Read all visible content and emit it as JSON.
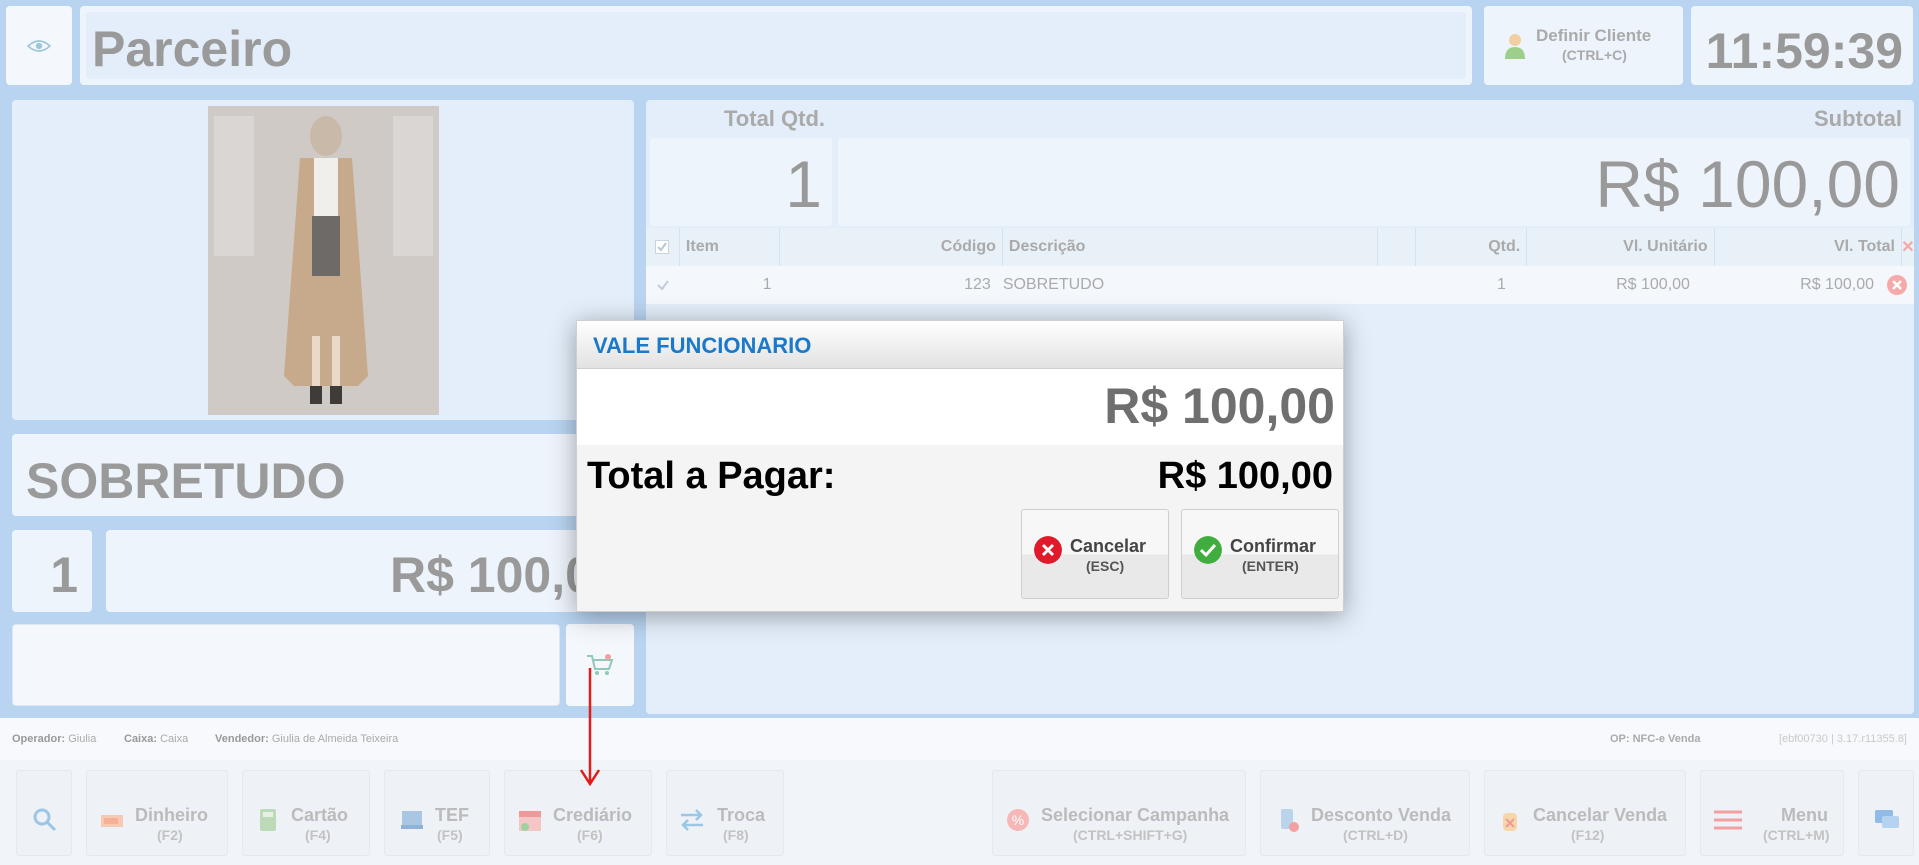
{
  "header": {
    "title": "Parceiro",
    "client_button": {
      "label": "Definir Cliente",
      "shortcut": "(CTRL+C)"
    },
    "clock": "11:59:39"
  },
  "product": {
    "name": "SOBRETUDO",
    "quantity": "1",
    "price": "R$ 100,00"
  },
  "totals": {
    "qty_label": "Total Qtd.",
    "qty_value": "1",
    "subtotal_label": "Subtotal",
    "subtotal_value": "R$ 100,00"
  },
  "table": {
    "headers": [
      "Item",
      "Código",
      "Descrição",
      "Qtd.",
      "Vl. Unitário",
      "Vl. Total"
    ],
    "rows": [
      {
        "item": "1",
        "codigo": "123",
        "descricao": "SOBRETUDO",
        "qtd": "1",
        "unitario": "R$ 100,00",
        "total": "R$ 100,00"
      }
    ]
  },
  "status": {
    "operador_label": "Operador:",
    "operador": "Giulia",
    "caixa_label": "Caixa:",
    "caixa": "Caixa",
    "vendedor_label": "Vendedor:",
    "vendedor": "Giulia de Almeida Teixeira",
    "op": "OP: NFC-e Venda",
    "version": "[ebf00730 | 3.17.r11355.8]"
  },
  "actions": [
    {
      "label": "Dinheiro",
      "key": "(F2)"
    },
    {
      "label": "Cartão",
      "key": "(F4)"
    },
    {
      "label": "TEF",
      "key": "(F5)"
    },
    {
      "label": "Crediário",
      "key": "(F6)"
    },
    {
      "label": "Troca",
      "key": "(F8)"
    },
    {
      "label": "Selecionar Campanha",
      "key": "(CTRL+SHIFT+G)"
    },
    {
      "label": "Desconto Venda",
      "key": "(CTRL+D)"
    },
    {
      "label": "Cancelar Venda",
      "key": "(F12)"
    },
    {
      "label": "Menu",
      "key": "(CTRL+M)"
    }
  ],
  "dialog": {
    "title": "VALE FUNCIONARIO",
    "amount": "R$ 100,00",
    "total_label": "Total a Pagar:",
    "total_value": "R$ 100,00",
    "cancel": {
      "label": "Cancelar",
      "key": "(ESC)"
    },
    "confirm": {
      "label": "Confirmar",
      "key": "(ENTER)"
    }
  },
  "colors": {
    "dialog_title": "#1a7ac9",
    "cancel_icon": "#e0192b",
    "confirm_icon": "#3fae3f",
    "annotation_arrow": "#e21b1b"
  },
  "icons": [
    "eye-icon",
    "user-icon",
    "cart-icon",
    "search-icon",
    "cash-icon",
    "card-icon",
    "tef-icon",
    "calendar-icon",
    "swap-icon",
    "percent-icon",
    "discount-icon",
    "cancel-hand-icon",
    "menu-icon",
    "chat-icon",
    "cancel-icon",
    "confirm-icon"
  ]
}
